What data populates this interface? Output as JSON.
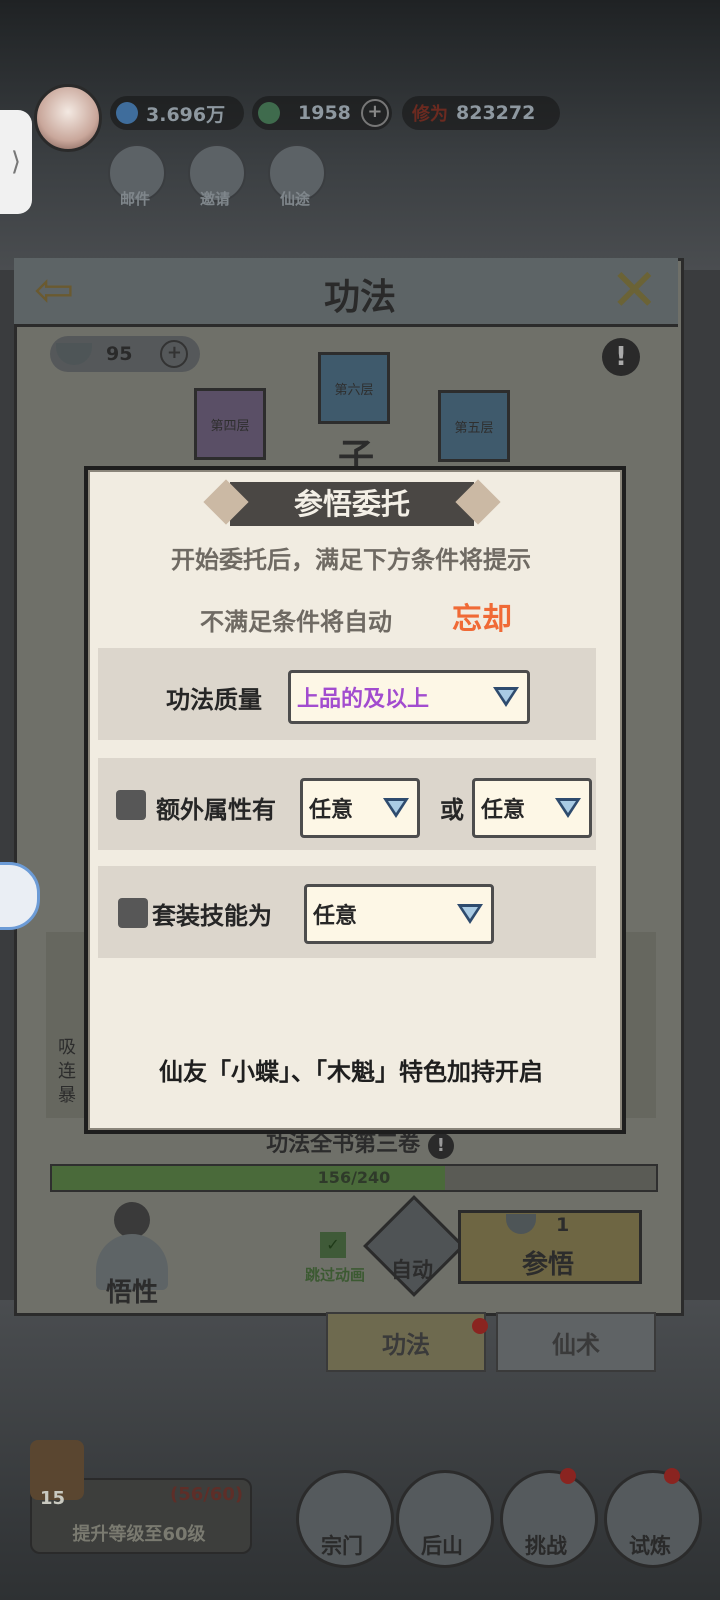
{
  "top_bar": {
    "side_tab_icon": "chevron-right-icon",
    "spirit_stone": "3.696万",
    "jade": "1958",
    "cultivation_label": "修为",
    "cultivation_value": "823272",
    "buttons": [
      {
        "label": "邮件",
        "icon": "mail-icon"
      },
      {
        "label": "邀请",
        "icon": "invite-icon"
      },
      {
        "label": "仙途",
        "icon": "path-icon"
      }
    ]
  },
  "panel": {
    "title": "功法",
    "resource_count": "95",
    "layers": {
      "left": "第四层",
      "center": "第六层",
      "right": "第五层"
    },
    "peek_char": "子",
    "side_text": [
      "吸",
      "连",
      "暴"
    ],
    "book_title": "功法全书第三卷",
    "progress_text": "156/240",
    "progress_value": 0.65,
    "character_label": "悟性",
    "skip_anim_label": "跳过动画",
    "auto_label": "自动",
    "comprehend_label": "参悟",
    "comprehend_cost": "1"
  },
  "tabs": [
    {
      "label": "功法",
      "active": true
    },
    {
      "label": "仙术",
      "active": false
    }
  ],
  "bottom": {
    "level_number": "15",
    "level_progress": "(56/60)",
    "level_goal": "提升等级至60级",
    "nav": [
      {
        "label": "宗门",
        "icon": "sect-gate-icon"
      },
      {
        "label": "后山",
        "icon": "mountain-icon"
      },
      {
        "label": "挑战",
        "icon": "sword-icon"
      },
      {
        "label": "试炼",
        "icon": "scroll-icon"
      }
    ]
  },
  "dialog": {
    "title": "参悟委托",
    "line1": "开始委托后，满足下方条件将提示",
    "line2": "不满足条件将自动",
    "forget": "忘却",
    "quality_label": "功法质量",
    "quality_value": "上品的及以上",
    "extra_attr_label": "额外属性有",
    "extra_attr_value1": "任意",
    "or_label": "或",
    "extra_attr_value2": "任意",
    "set_skill_label": "套装技能为",
    "set_skill_value": "任意",
    "footer": "仙友「小蝶」、「木魁」特色加持开启"
  },
  "colors": {
    "dialog_bg": "#f1ece1",
    "forget_accent": "#f06a36",
    "quality_purple": "#a24ccf",
    "dropdown_bg": "#fdf7e6"
  }
}
